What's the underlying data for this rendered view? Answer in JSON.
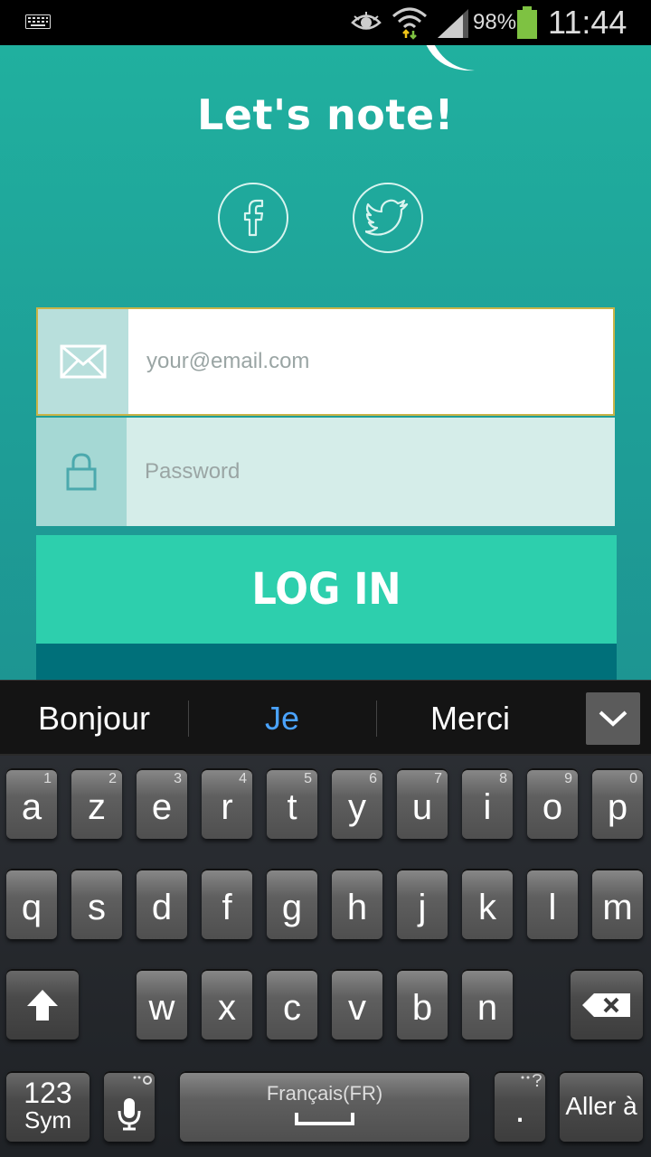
{
  "status_bar": {
    "battery": "98%",
    "time": "11:44"
  },
  "app": {
    "title": "Let's note!",
    "social": [
      "facebook-icon",
      "twitter-icon"
    ],
    "email_placeholder": "your@email.com",
    "password_placeholder": "Password",
    "login_label": "LOG IN"
  },
  "suggestions": [
    "Bonjour",
    "Je",
    "Merci"
  ],
  "keyboard": {
    "row1": [
      {
        "label": "a",
        "num": "1"
      },
      {
        "label": "z",
        "num": "2"
      },
      {
        "label": "e",
        "num": "3"
      },
      {
        "label": "r",
        "num": "4"
      },
      {
        "label": "t",
        "num": "5"
      },
      {
        "label": "y",
        "num": "6"
      },
      {
        "label": "u",
        "num": "7"
      },
      {
        "label": "i",
        "num": "8"
      },
      {
        "label": "o",
        "num": "9"
      },
      {
        "label": "p",
        "num": "0"
      }
    ],
    "row2": [
      "q",
      "s",
      "d",
      "f",
      "g",
      "h",
      "j",
      "k",
      "l",
      "m"
    ],
    "row3": [
      "w",
      "x",
      "c",
      "v",
      "b",
      "n"
    ],
    "sym_line1": "123",
    "sym_line2": "Sym",
    "space_label": "Français(FR)",
    "period": ".",
    "enter_label": "Aller à"
  }
}
